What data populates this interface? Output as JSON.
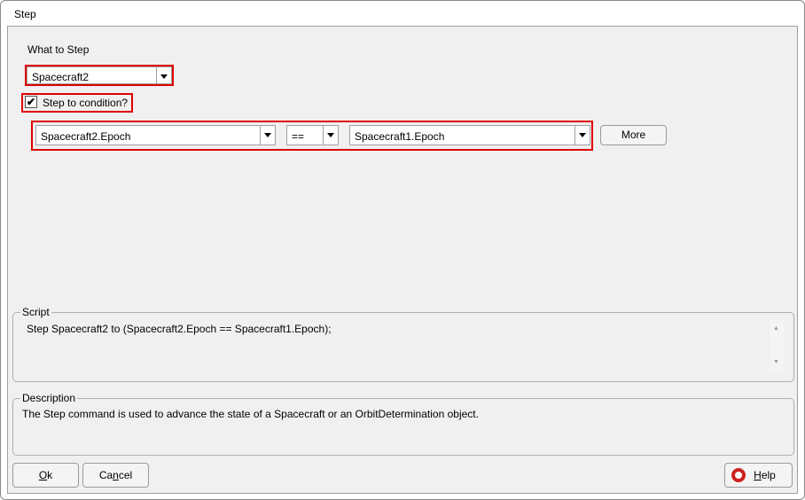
{
  "window": {
    "title": "Step"
  },
  "what_to_step": {
    "label": "What to Step",
    "value": "Spacecraft2"
  },
  "condition": {
    "checkbox_label": "Step to condition?",
    "checked": true,
    "left": "Spacecraft2.Epoch",
    "operator": "==",
    "right": "Spacecraft1.Epoch",
    "more_label": "More"
  },
  "script": {
    "label": "Script",
    "text": "Step Spacecraft2 to (Spacecraft2.Epoch == Spacecraft1.Epoch);"
  },
  "description": {
    "label": "Description",
    "text": "The Step command is used to advance the state of a Spacecraft or an OrbitDetermination object."
  },
  "buttons": {
    "ok_mn": "O",
    "ok_rest": "k",
    "cancel_a": "Ca",
    "cancel_mn": "n",
    "cancel_b": "cel",
    "help_mn": "H",
    "help_rest": "elp"
  },
  "colors": {
    "highlight": "#e00000",
    "help_icon": "#cc2222"
  }
}
